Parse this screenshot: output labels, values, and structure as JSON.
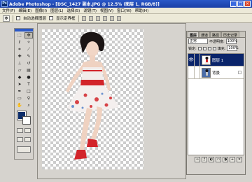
{
  "window": {
    "title": "Adobe Photoshop - [DSC_1427 副本.JPG @ 12.5% (图层 1, RGB/8)]",
    "app_icon": "Ps",
    "min": "_",
    "max": "□",
    "close": "×"
  },
  "menu": [
    "文件(F)",
    "编辑(E)",
    "图像(I)",
    "图层(L)",
    "选择(S)",
    "滤镜(T)",
    "视图(V)",
    "窗口(W)",
    "帮助(H)"
  ],
  "options": {
    "auto_select_label": "自动选择图层",
    "show_bounds_label": "显示定界框"
  },
  "toolbox": {
    "foreground_color": "#0d2d6a",
    "background_color": "#ffffff"
  },
  "layers_panel": {
    "tabs": [
      "图层",
      "通道",
      "路径",
      "历史记录"
    ],
    "blend_mode": "正常",
    "opacity_label": "不透明度:",
    "opacity": "100%",
    "lock_label": "锁定:",
    "fill_label": "填充:",
    "fill": "100%",
    "layers": [
      {
        "name": "图层 1",
        "selected": true
      },
      {
        "name": "背景",
        "selected": false
      }
    ],
    "eye_glyph": "👁"
  },
  "colors": {
    "title_bar": "#1a3fa6",
    "selected_layer": "#0a246a",
    "dress_red": "#d2242a"
  }
}
